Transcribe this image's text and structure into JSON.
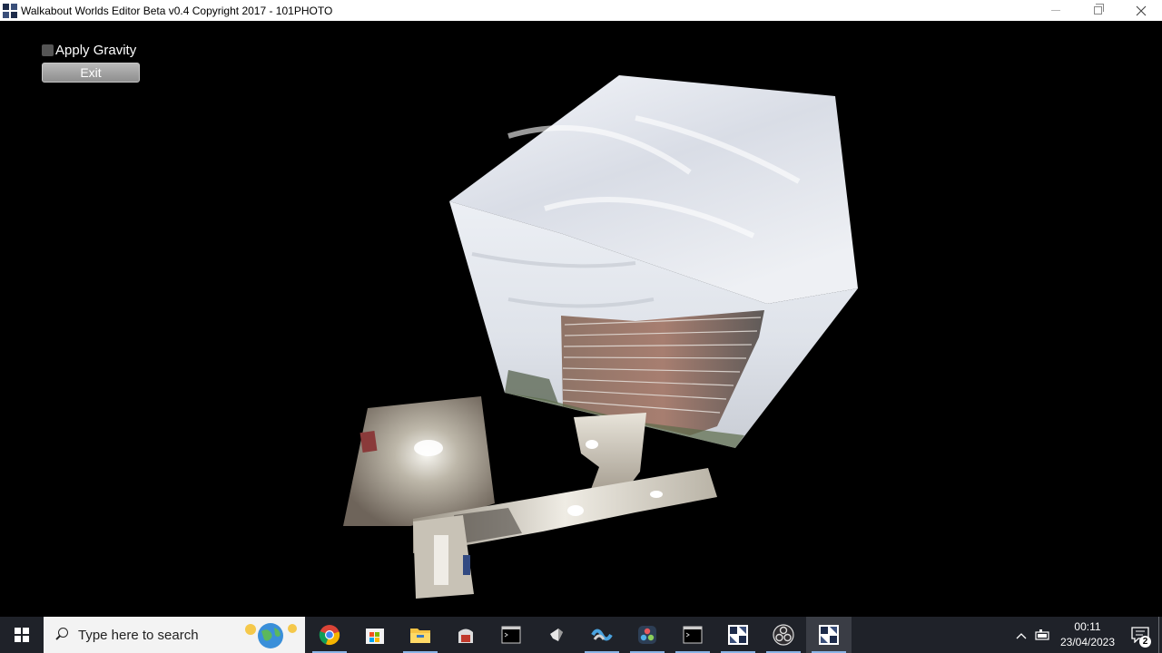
{
  "window": {
    "title": "Walkabout Worlds Editor Beta v0.4 Copyright 2017 - 101PHOTO"
  },
  "controls": {
    "gravity_label": "Apply Gravity",
    "gravity_checked": false,
    "exit_label": "Exit"
  },
  "taskbar": {
    "search_placeholder": "Type here to search",
    "apps": [
      {
        "name": "chrome-icon",
        "running": true
      },
      {
        "name": "microsoft-store-icon",
        "running": false
      },
      {
        "name": "file-explorer-icon",
        "running": true
      },
      {
        "name": "app-icon",
        "running": false
      },
      {
        "name": "terminal-icon",
        "running": false
      },
      {
        "name": "app-icon",
        "running": false
      },
      {
        "name": "app-icon",
        "running": true
      },
      {
        "name": "davinci-resolve-icon",
        "running": true
      },
      {
        "name": "terminal-icon",
        "running": true
      },
      {
        "name": "walkabout-worlds-icon",
        "running": true
      },
      {
        "name": "obs-icon",
        "running": true
      },
      {
        "name": "walkabout-worlds-icon",
        "running": true
      }
    ],
    "clock_time": "00:11",
    "clock_date": "23/04/2023",
    "notification_count": "2"
  },
  "colors": {
    "viewport_background": "#000000",
    "taskbar_background": "#1f2229",
    "titlebar_background": "#ffffff"
  }
}
